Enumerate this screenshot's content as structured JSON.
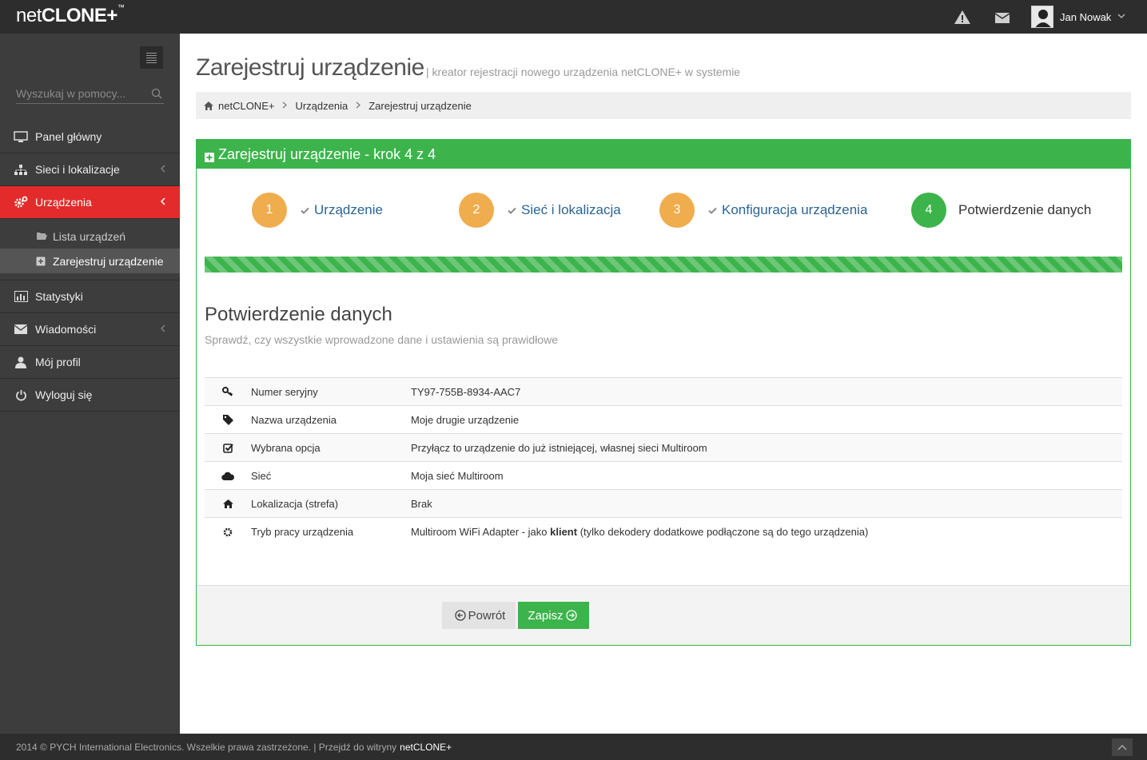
{
  "app": {
    "logo_thin": "net",
    "logo_bold": "CLONE+",
    "logo_tm": "™"
  },
  "topbar": {
    "user_name": "Jan Nowak",
    "icons": [
      "warning-icon",
      "mail-icon",
      "avatar",
      "chevron-down-icon"
    ]
  },
  "sidebar": {
    "search_placeholder": "Wyszukaj w pomocy...",
    "items": [
      {
        "label": "Panel główny",
        "icon": "monitor-icon"
      },
      {
        "label": "Sieci i lokalizacje",
        "icon": "sitemap-icon"
      },
      {
        "label": "Urządzenia",
        "icon": "cogs-icon",
        "active": true
      },
      {
        "label": "Statystyki",
        "icon": "bar-chart-icon"
      },
      {
        "label": "Wiadomości",
        "icon": "envelope-icon"
      },
      {
        "label": "Mój profil",
        "icon": "user-icon"
      },
      {
        "label": "Wyloguj się",
        "icon": "power-icon"
      }
    ],
    "subitems": [
      {
        "label": "Lista urządzeń",
        "icon": "folder-open-icon"
      },
      {
        "label": "Zarejestruj urządzenie",
        "icon": "plus-square-icon",
        "current": true
      }
    ]
  },
  "page": {
    "title": "Zarejestruj urządzenie",
    "subtitle": "| kreator rejestracji nowego urządzenia netCLONE+ w systemie"
  },
  "breadcrumb": [
    "netCLONE+",
    "Urządzenia",
    "Zarejestruj urządzenie"
  ],
  "wizard": {
    "heading": "Zarejestruj urządzenie - krok 4 z 4",
    "steps": [
      {
        "num": "1",
        "label": "Urządzenie",
        "done": true
      },
      {
        "num": "2",
        "label": "Sieć i lokalizacja",
        "done": true
      },
      {
        "num": "3",
        "label": "Konfiguracja urządzenia",
        "done": true
      },
      {
        "num": "4",
        "label": "Potwierdzenie danych",
        "done": false
      }
    ],
    "progress_percent": 100,
    "section_title": "Potwierdzenie danych",
    "section_subtitle": "Sprawdź, czy wszystkie wprowadzone dane i ustawienia są prawidłowe",
    "rows": [
      {
        "icon": "key-icon",
        "label": "Numer seryjny",
        "value": "TY97-755B-8934-AAC7"
      },
      {
        "icon": "tag-icon",
        "label": "Nazwa urządzenia",
        "value": "Moje drugie urządzenie"
      },
      {
        "icon": "check-square-icon",
        "label": "Wybrana opcja",
        "value": "Przyłącz to urządzenie do już istniejącej, własnej sieci Multiroom"
      },
      {
        "icon": "cloud-icon",
        "label": "Sieć",
        "value": "Moja sieć Multiroom"
      },
      {
        "icon": "home-icon",
        "label": "Lokalizacja (strefa)",
        "value": "Brak"
      },
      {
        "icon": "gear-icon",
        "label": "Tryb pracy urządzenia",
        "value_pre": "Multiroom WiFi Adapter - jako ",
        "value_bold": "klient",
        "value_post": " (tylko dekodery dodatkowe podłączone są do tego urządzenia)"
      }
    ],
    "back_label": "Powrót",
    "save_label": "Zapisz"
  },
  "footer": {
    "text": "2014 © PYCH International Electronics. Wszelkie prawa zastrzeżone. | Przejdź do witryny",
    "link": "netCLONE+"
  },
  "colors": {
    "accent_green": "#3cb44b",
    "step_done": "#f0ad4e",
    "sidebar_active": "#e32b2b",
    "sidebar_bg": "#3d3d3d",
    "topbar_bg": "#2d2d2d"
  }
}
